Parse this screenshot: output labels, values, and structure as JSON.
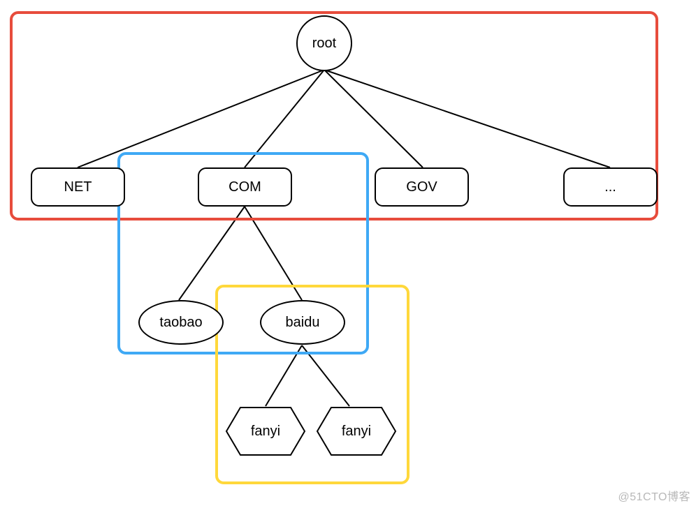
{
  "diagram": {
    "root": "root",
    "tlds": {
      "net": "NET",
      "com": "COM",
      "gov": "GOV",
      "more": "..."
    },
    "secondLevel": {
      "taobao": "taobao",
      "baidu": "baidu"
    },
    "thirdLevel": {
      "fanyi1": "fanyi",
      "fanyi2": "fanyi"
    }
  },
  "watermark": "@51CTO博客"
}
